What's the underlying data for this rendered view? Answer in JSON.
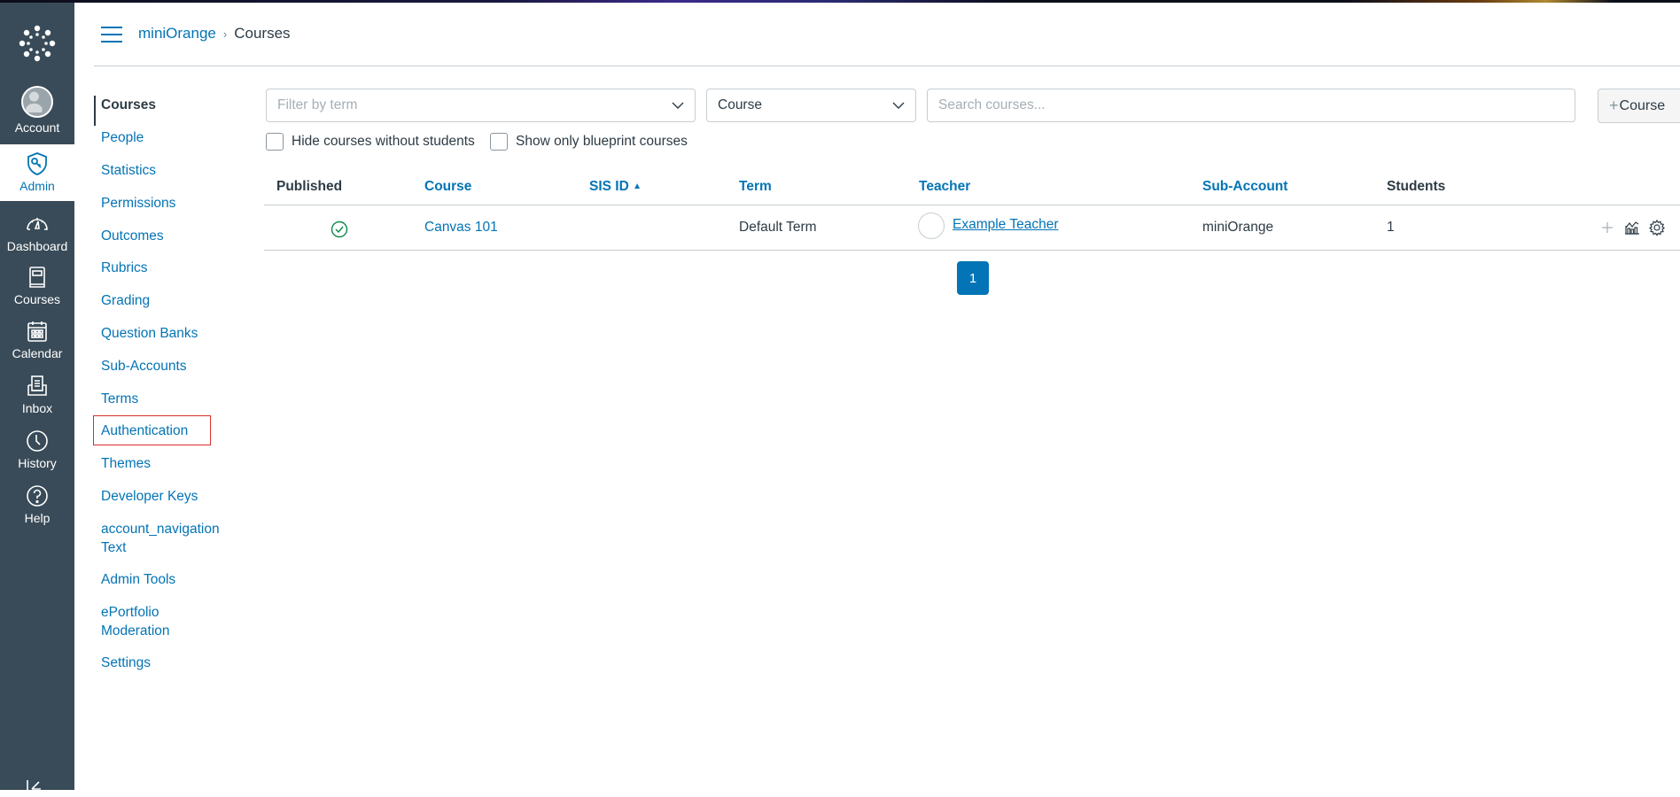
{
  "global_nav": {
    "logo_icon": "canvas-logo-icon",
    "items": [
      {
        "label": "Account",
        "icon": "avatar-icon"
      },
      {
        "label": "Admin",
        "icon": "shield-key-icon",
        "active": true
      },
      {
        "label": "Dashboard",
        "icon": "speedometer-icon"
      },
      {
        "label": "Courses",
        "icon": "book-icon"
      },
      {
        "label": "Calendar",
        "icon": "calendar-icon"
      },
      {
        "label": "Inbox",
        "icon": "inbox-icon"
      },
      {
        "label": "History",
        "icon": "clock-icon"
      },
      {
        "label": "Help",
        "icon": "question-icon"
      }
    ],
    "collapse_icon": "collapse-arrow-icon"
  },
  "header": {
    "menu_icon": "hamburger-icon",
    "breadcrumb": [
      {
        "label": "miniOrange",
        "link": true
      },
      {
        "label": "Courses",
        "link": false
      }
    ],
    "breadcrumb_separator": "›"
  },
  "section_nav": {
    "items": [
      {
        "label": "Courses",
        "active": true
      },
      {
        "label": "People"
      },
      {
        "label": "Statistics"
      },
      {
        "label": "Permissions"
      },
      {
        "label": "Outcomes"
      },
      {
        "label": "Rubrics"
      },
      {
        "label": "Grading"
      },
      {
        "label": "Question Banks"
      },
      {
        "label": "Sub-Accounts"
      },
      {
        "label": "Terms"
      },
      {
        "label": "Authentication",
        "highlighted": true
      },
      {
        "label": "Themes"
      },
      {
        "label": "Developer Keys"
      },
      {
        "label": "account_navigation",
        "label2": "Text"
      },
      {
        "label": "Admin Tools"
      },
      {
        "label": "ePortfolio",
        "label2": "Moderation"
      },
      {
        "label": "Settings"
      }
    ]
  },
  "filters": {
    "term_select": {
      "placeholder": "Filter by term",
      "value": ""
    },
    "type_select": {
      "value": "Course"
    },
    "search": {
      "placeholder": "Search courses...",
      "value": ""
    },
    "add_course_label": "Course",
    "add_course_icon": "plus-icon",
    "hide_without_students": {
      "label": "Hide courses without students",
      "checked": false
    },
    "blueprint_only": {
      "label": "Show only blueprint courses",
      "checked": false
    }
  },
  "table": {
    "columns": [
      {
        "label": "Published",
        "sortable": false
      },
      {
        "label": "Course",
        "sortable": true
      },
      {
        "label": "SIS ID",
        "sortable": true,
        "sort_indicator": "▲"
      },
      {
        "label": "Term",
        "sortable": true
      },
      {
        "label": "Teacher",
        "sortable": true
      },
      {
        "label": "Sub-Account",
        "sortable": true
      },
      {
        "label": "Students",
        "sortable": false
      }
    ],
    "rows": [
      {
        "published": true,
        "published_icon": "check-circle-icon",
        "course": "Canvas 101",
        "sis_id": "",
        "term": "Default Term",
        "teacher": "Example Teacher",
        "sub_account": "miniOrange",
        "students": "1",
        "actions": [
          "plus-icon",
          "analytics-icon",
          "gear-icon"
        ]
      }
    ]
  },
  "pagination": {
    "current_page": "1"
  },
  "colors": {
    "nav_bg": "#394b58",
    "brand_blue": "#0374b5",
    "text": "#2d3b45",
    "success": "#0b874b",
    "highlight_box": "#d9302c"
  }
}
